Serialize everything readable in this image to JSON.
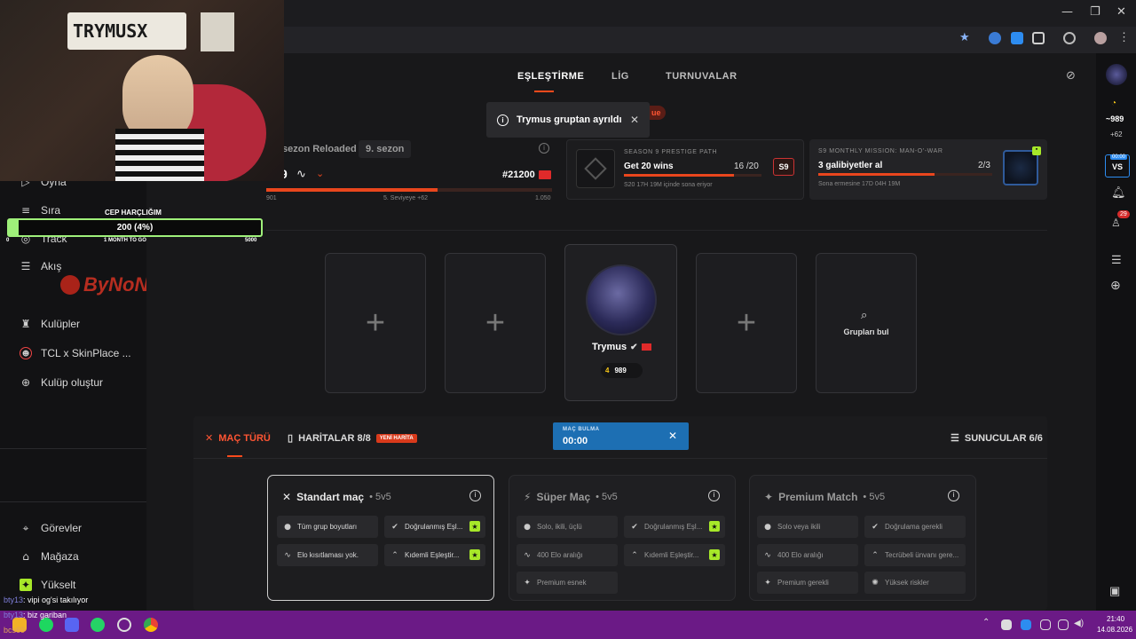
{
  "window": {
    "minimize": "—",
    "maximize": "❐",
    "close": "✕"
  },
  "webcam": {
    "sign_text": "TRYMUSX"
  },
  "donation_goal": {
    "title": "CEP HARÇLIĞIM",
    "amount": "200 (4%)",
    "min": "0",
    "subtitle": "1 MONTH TO GO",
    "max": "5000",
    "progress_fraction": 0.04
  },
  "watermark": {
    "text": "ByNoName"
  },
  "sidebar": {
    "items": [
      {
        "label": "Oyna",
        "icon": "play-icon"
      },
      {
        "label": "Sıra",
        "icon": "queue-icon"
      },
      {
        "label": "Track",
        "icon": "track-icon"
      },
      {
        "label": "Akış",
        "icon": "feed-icon"
      },
      {
        "label": "Kulüpler",
        "icon": "clubs-icon"
      },
      {
        "label": "TCL x SkinPlace ...",
        "icon": "club-avatar-icon"
      },
      {
        "label": "Kulüp oluştur",
        "icon": "plus-circle-icon"
      },
      {
        "label": "Görevler",
        "icon": "missions-icon"
      },
      {
        "label": "Mağaza",
        "icon": "store-icon"
      },
      {
        "label": "Yükselt",
        "icon": "upgrade-icon"
      }
    ]
  },
  "chat": {
    "lines": [
      {
        "user": "bty13",
        "text": ": vipi og'si takılıyor"
      },
      {
        "user": "bty13",
        "text": ": biz gariban"
      },
      {
        "user": "bcs69",
        "text": ""
      }
    ]
  },
  "top_tabs": [
    "EŞLEŞTİRME",
    "LİG",
    "TURNUVALAR"
  ],
  "toast": {
    "text": "Trymus gruptan ayrıldı",
    "badge": "ue"
  },
  "profile": {
    "season_a": "sezon Reloaded",
    "season_b": "9. sezon",
    "level_num": "9",
    "rank": "#21200",
    "bar_left": "901",
    "bar_mid": "5. Seviyeye +62",
    "bar_right": "1.050",
    "level_progress_fraction": 0.6
  },
  "prestige": {
    "header": "SEASON 9 PRESTIGE PATH",
    "goal": "Get 20 wins",
    "progress": "16 /20",
    "badge": "S9",
    "footer": "S20 17H 19M içinde sona eriyor",
    "progress_fraction": 0.8
  },
  "monthly": {
    "header": "S9 MONTHLY MISSION: MAN-O'-WAR",
    "goal": "3 galibiyetler al",
    "progress": "2/3",
    "footer": "Sona ermesine 17D 04H 19M",
    "progress_fraction": 0.67
  },
  "party": {
    "empty_symbol": "+",
    "player_name": "Trymus",
    "player_level": "4",
    "player_elo": "989",
    "find_groups": "Grupları bul"
  },
  "match_panel": {
    "tab_mode": "MAÇ TÜRÜ",
    "tab_maps": "HARİTALAR 8/8",
    "tab_maps_badge": "YENİ HARİTA",
    "tab_servers": "SUNUCULAR 6/6",
    "search_label": "MAÇ BULMA",
    "search_timer": "00:00"
  },
  "modes": [
    {
      "title": "Standart maç",
      "sub": "• 5v5",
      "chips": [
        "Tüm grup boyutları",
        "Doğrulanmış Eşl...",
        "Elo kısıtlaması yok.",
        "Kıdemli Eşleştir..."
      ]
    },
    {
      "title": "Süper Maç",
      "sub": "• 5v5",
      "chips": [
        "Solo, ikili, üçlü",
        "Doğrulanmış Eşl...",
        "400 Elo aralığı",
        "Kıdemli Eşleştir...",
        "Premium esnek"
      ]
    },
    {
      "title": "Premium Match",
      "sub": "• 5v5",
      "chips": [
        "Solo veya ikili",
        "Doğrulama gerekli",
        "400 Elo aralığı",
        "Tecrübeli ünvanı gere...",
        "Premium gerekli",
        "Yüksek riskler"
      ]
    }
  ],
  "right_rail": {
    "elo": "~989",
    "elo_delta": "+62",
    "vs_timer": "00:00",
    "notif_count": "29"
  },
  "taskbar": {
    "time": "21:40",
    "date": "14.08.2026"
  },
  "colors": {
    "accent": "#ff4a1c",
    "brand_green": "#a7e829",
    "search_blue": "#1d6fb3",
    "taskbar": "#6b1a86"
  }
}
